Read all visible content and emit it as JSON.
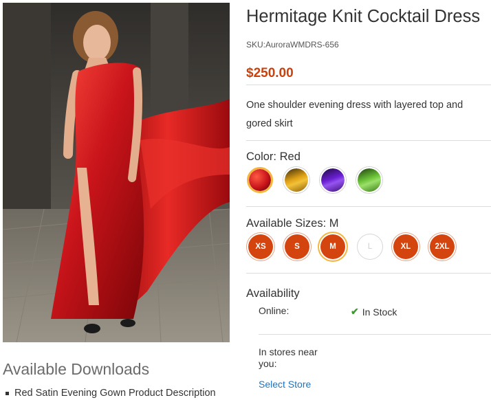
{
  "product": {
    "image_alt": "Model in red satin one-shoulder evening gown",
    "title": "Hermitage Knit Cocktail Dress",
    "sku": "SKU:AuroraWMDRS-656",
    "price": "$250.00",
    "description": "One shoulder evening dress with layered top and gored skirt"
  },
  "color": {
    "label": "Color: Red",
    "selected": "Red",
    "swatches": [
      {
        "name": "Red",
        "hex": "#c8141a",
        "selected": true
      },
      {
        "name": "Gold",
        "hex": "#e2a316",
        "selected": false
      },
      {
        "name": "Purple",
        "hex": "#6a1fd1",
        "selected": false
      },
      {
        "name": "Green",
        "hex": "#6bc238",
        "selected": false
      }
    ]
  },
  "sizes": {
    "label": "Available Sizes: M",
    "options": [
      {
        "label": "XS",
        "available": true,
        "selected": false
      },
      {
        "label": "S",
        "available": true,
        "selected": false
      },
      {
        "label": "M",
        "available": true,
        "selected": true
      },
      {
        "label": "L",
        "available": false,
        "selected": false
      },
      {
        "label": "XL",
        "available": true,
        "selected": false
      },
      {
        "label": "2XL",
        "available": true,
        "selected": false
      }
    ]
  },
  "availability": {
    "title": "Availability",
    "online_label": "Online:",
    "online_status": "In Stock",
    "stores_label": "In stores near you:",
    "select_store": "Select Store"
  },
  "downloads": {
    "title": "Available Downloads",
    "items": [
      "Red Satin Evening Gown Product Description"
    ]
  },
  "colors": {
    "accent": "#d4440e",
    "price": "#c7420f",
    "selected_ring": "#f4b63f",
    "link": "#1c74c4",
    "in_stock": "#3b9b2e"
  }
}
